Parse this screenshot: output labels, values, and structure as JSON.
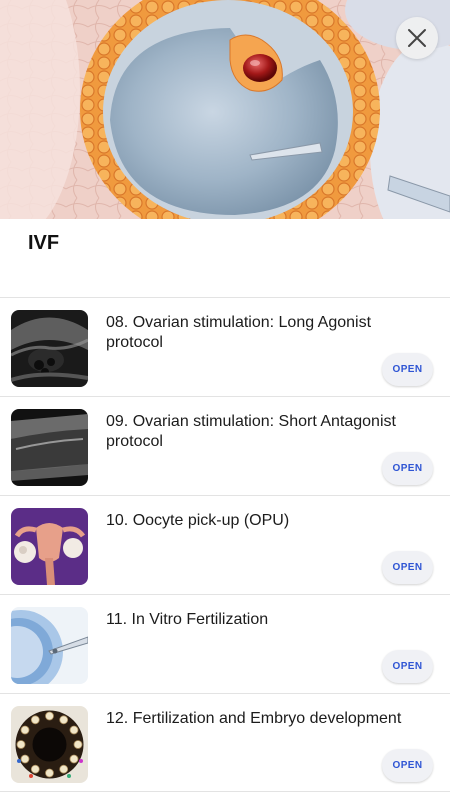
{
  "header": {
    "title": "IVF",
    "close_icon": "close-icon"
  },
  "colors": {
    "accent": "#2f55d4",
    "button_bg": "#f0f1f5",
    "divider": "#e3e3e3"
  },
  "lessons": [
    {
      "title": "08. Ovarian stimulation: Long Agonist protocol",
      "button": "OPEN",
      "thumbnail": "ultrasound-image"
    },
    {
      "title": "09. Ovarian stimulation: Short Antagonist protocol",
      "button": "OPEN",
      "thumbnail": "ultrasound-image"
    },
    {
      "title": "10. Oocyte pick-up (OPU)",
      "button": "OPEN",
      "thumbnail": "uterus-ovaries-illustration"
    },
    {
      "title": "11. In Vitro Fertilization",
      "button": "OPEN",
      "thumbnail": "oocyte-injection-illustration"
    },
    {
      "title": "12. Fertilization and Embryo development",
      "button": "OPEN",
      "thumbnail": "embryo-development-wheel"
    }
  ]
}
